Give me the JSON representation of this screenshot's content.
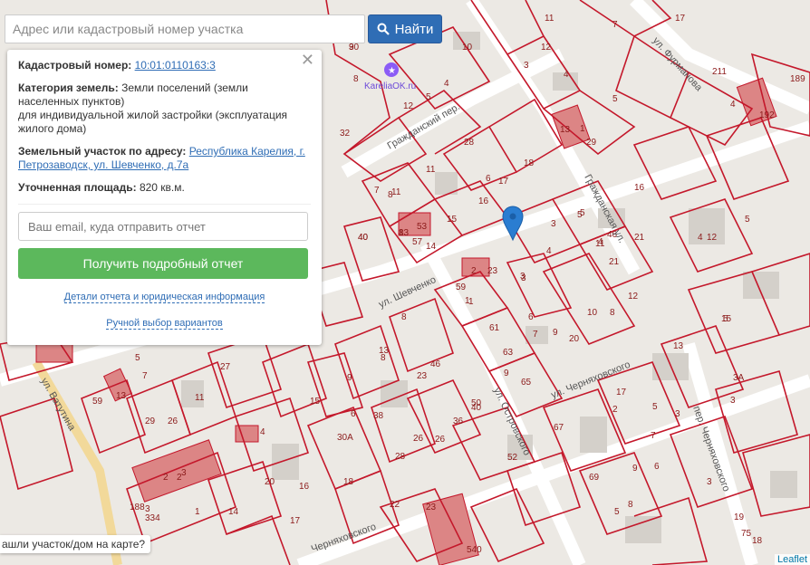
{
  "search": {
    "placeholder": "Адрес или кадастровый номер участка",
    "button_label": "Найти"
  },
  "info": {
    "cadastral_label": "Кадастровый номер:",
    "cadastral_value": "10:01:0110163:3",
    "category_label": "Категория земель:",
    "category_value": "Земли поселений (земли населенных пунктов)",
    "category_usage": "для индивидуальной жилой застройки (эксплуатация жилого дома)",
    "address_label": "Земельный участок по адресу:",
    "address_value": "Республика Карелия, г. Петрозаводск, ул. Шевченко, д.7а",
    "area_label": "Уточненная площадь:",
    "area_value": "820 кв.м.",
    "email_placeholder": "Ваш email, куда отправить отчет",
    "report_button": "Получить подробный отчет",
    "details_link": "Детали отчета и юридическая информация",
    "manual_link": "Ручной выбор вариантов"
  },
  "map": {
    "streets": [
      {
        "name": "ул. Шевченко"
      },
      {
        "name": "ул. Ватутина"
      },
      {
        "name": "ул. Островского"
      },
      {
        "name": "ул. Черняховского"
      },
      {
        "name": "Гражданский пер."
      },
      {
        "name": "Гражданская ул."
      },
      {
        "name": "ул. Фурманова"
      },
      {
        "name": "пер. Черняховского"
      },
      {
        "name": "Черняховского"
      }
    ],
    "poi_label": "KareliaOK.ru",
    "lots": [
      "30",
      "10",
      "8",
      "4",
      "32",
      "5",
      "11",
      "28",
      "6",
      "12",
      "15",
      "16",
      "17",
      "18",
      "7",
      "8",
      "13",
      "53",
      "14",
      "57",
      "40",
      "59",
      "23",
      "1",
      "2",
      "3",
      "4",
      "5",
      "11",
      "46",
      "21",
      "10",
      "8",
      "9",
      "20",
      "12",
      "16",
      "1",
      "5",
      "15",
      "4",
      "12",
      "3",
      "9",
      "7",
      "61",
      "63",
      "65",
      "6",
      "9",
      "13",
      "3",
      "3А",
      "5",
      "40",
      "1",
      "3",
      "23",
      "46",
      "26",
      "27",
      "11",
      "29",
      "26",
      "13",
      "7",
      "5",
      "59",
      "4",
      "8",
      "15",
      "9",
      "6",
      "38",
      "30А",
      "28",
      "26",
      "36",
      "40",
      "52",
      "50",
      "67",
      "69",
      "17",
      "2",
      "7",
      "5",
      "6",
      "3",
      "2",
      "20",
      "16",
      "18",
      "22",
      "23",
      "17",
      "14",
      "188",
      "334",
      "2",
      "3",
      "1",
      "3",
      "540",
      "5",
      "8",
      "19",
      "75",
      "18",
      "17",
      "211",
      "189",
      "192",
      "4",
      "5",
      "13",
      "29",
      "3",
      "11",
      "12",
      "4",
      "7",
      "21",
      "5",
      "3",
      "4",
      "11",
      "8",
      "13",
      "8",
      "9"
    ],
    "pin_color": "#2a7dd1",
    "lot_color": "#c4182b"
  },
  "hint": "ашли участок/дом на карте?",
  "attribution": "Leaflet"
}
